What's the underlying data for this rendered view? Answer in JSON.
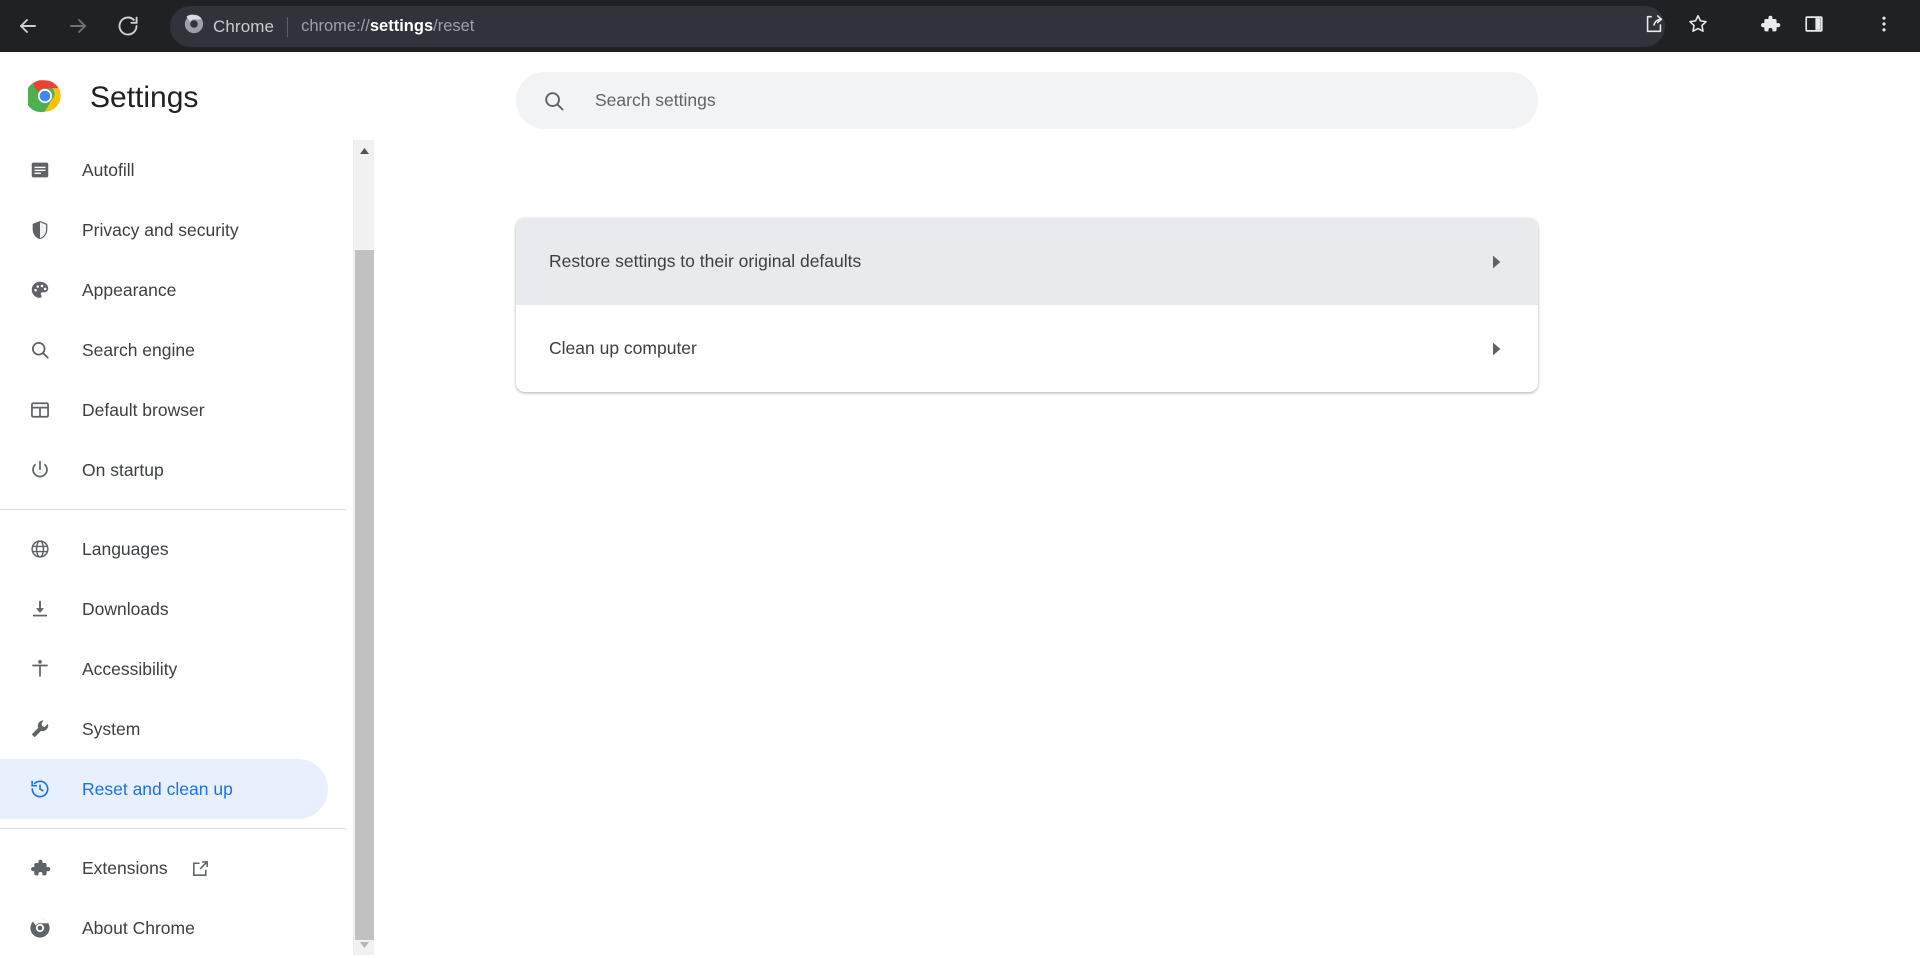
{
  "browser": {
    "nav": {
      "back": "back-arrow",
      "forward": "forward-arrow",
      "reload": "reload"
    },
    "omnibox": {
      "chip_icon": "chrome-logo",
      "chip_label": "Chrome",
      "url_prefix": "chrome://",
      "url_strong": "settings",
      "url_suffix": "/reset"
    },
    "actions": [
      {
        "name": "share-icon",
        "label": "Share"
      },
      {
        "name": "bookmark-star-icon",
        "label": "Bookmark this tab"
      },
      {
        "name": "extensions-puzzle-icon",
        "label": "Extensions"
      },
      {
        "name": "side-panel-icon",
        "label": "Side panel"
      },
      {
        "name": "more-vert-icon",
        "label": "Customize and control Google Chrome"
      }
    ]
  },
  "sidebar": {
    "title": "Settings",
    "logo": "chrome-logo",
    "items": [
      {
        "label": "Autofill",
        "icon": "autofill-icon",
        "selected": false
      },
      {
        "label": "Privacy and security",
        "icon": "shield-icon",
        "selected": false
      },
      {
        "label": "Appearance",
        "icon": "palette-icon",
        "selected": false
      },
      {
        "label": "Search engine",
        "icon": "search-icon",
        "selected": false
      },
      {
        "label": "Default browser",
        "icon": "browser-window-icon",
        "selected": false
      },
      {
        "label": "On startup",
        "icon": "power-icon",
        "selected": false
      },
      {
        "label": "Languages",
        "icon": "globe-icon",
        "selected": false
      },
      {
        "label": "Downloads",
        "icon": "download-icon",
        "selected": false
      },
      {
        "label": "Accessibility",
        "icon": "accessibility-icon",
        "selected": false
      },
      {
        "label": "System",
        "icon": "wrench-icon",
        "selected": false
      },
      {
        "label": "Reset and clean up",
        "icon": "history-restore-icon",
        "selected": true
      },
      {
        "label": "Extensions",
        "icon": "puzzle-icon",
        "selected": false,
        "external": "open-in-new-icon"
      },
      {
        "label": "About Chrome",
        "icon": "chrome-outline-icon",
        "selected": false
      }
    ],
    "scrollbar": {
      "up_arrow": "scroll-up-arrow",
      "down_arrow": "scroll-down-arrow"
    }
  },
  "search": {
    "icon": "search-icon",
    "placeholder": "Search settings",
    "value": ""
  },
  "main": {
    "section_title": "Reset and clean up",
    "rows": [
      {
        "label": "Restore settings to their original defaults",
        "arrow": "chevron-right-icon",
        "hovered": true
      },
      {
        "label": "Clean up computer",
        "arrow": "chevron-right-icon",
        "hovered": false
      }
    ]
  },
  "colors": {
    "toolbar_bg": "#202124",
    "omnibox_bg": "#31333a",
    "accent_blue": "#1a73e8",
    "selected_pill": "#e8f0fe",
    "row_hover": "#e8eaed",
    "cursor_dot": "#3f3d9e"
  }
}
